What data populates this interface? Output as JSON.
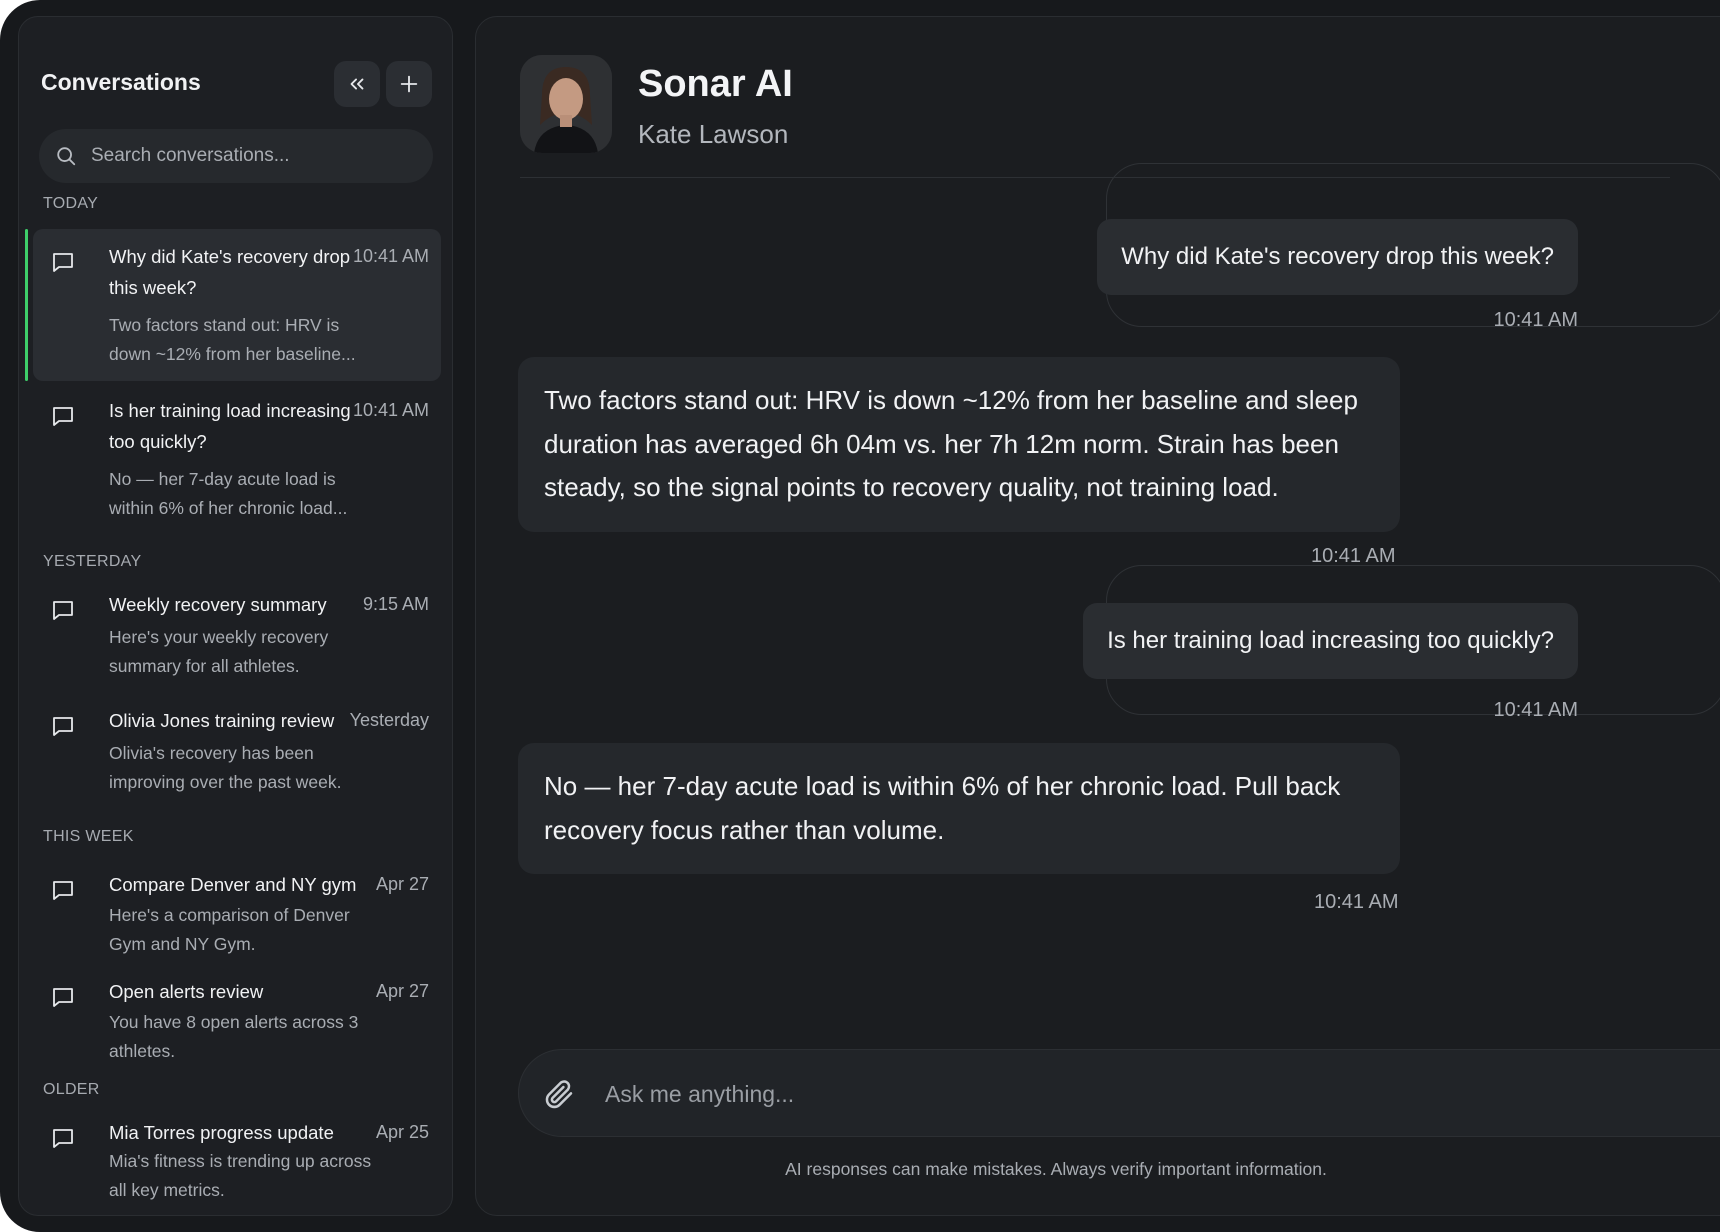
{
  "sidebar": {
    "title": "Conversations",
    "search_placeholder": "Search conversations...",
    "sections": {
      "today": "TODAY",
      "yesterday": "YESTERDAY",
      "this_week": "THIS WEEK",
      "older": "OLDER"
    },
    "conversations": [
      {
        "title": "Why did Kate's recovery drop this week?",
        "time": "10:41 AM",
        "preview": "Two factors stand out: HRV is down ~12% from her baseline...",
        "active": true
      },
      {
        "title": "Is her training load increasing too quickly?",
        "time": "10:41 AM",
        "preview": "No — her 7-day acute load is within 6% of her chronic load..."
      },
      {
        "title": "Weekly recovery summary",
        "time": "9:15 AM",
        "preview": "Here's your weekly recovery summary for all athletes."
      },
      {
        "title": "Olivia Jones training review",
        "time": "Yesterday",
        "preview": "Olivia's recovery has been improving over the past week."
      },
      {
        "title": "Compare Denver and NY gym",
        "time": "Apr 27",
        "preview": "Here's a comparison of Denver Gym and NY Gym."
      },
      {
        "title": "Open alerts review",
        "time": "Apr 27",
        "preview": "You have 8 open alerts across 3 athletes."
      },
      {
        "title": "Mia Torres progress update",
        "time": "Apr 25",
        "preview": "Mia's fitness is trending up across all key metrics."
      }
    ]
  },
  "header": {
    "agent_name": "Sonar AI",
    "athlete_name": "Kate Lawson"
  },
  "messages": [
    {
      "role": "user",
      "text": "Why did Kate's recovery drop this week?",
      "time": "10:41 AM"
    },
    {
      "role": "assistant",
      "text": "Two factors stand out: HRV is down ~12% from her baseline and sleep duration has averaged 6h 04m vs. her 7h 12m norm. Strain has been steady, so the signal points to recovery quality, not training load.",
      "time": "10:41 AM"
    },
    {
      "role": "user",
      "text": "Is her training load increasing too quickly?",
      "time": "10:41 AM"
    },
    {
      "role": "assistant",
      "text": "No — her 7-day acute load is within 6% of her chronic load. Pull back recovery focus rather than volume.",
      "time": "10:41 AM"
    }
  ],
  "composer": {
    "placeholder": "Ask me anything..."
  },
  "disclaimer": "AI responses can make mistakes. Always verify important information.",
  "colors": {
    "accent_active": "#3ecf6a",
    "background": "#17191c",
    "panel": "#1d1f23"
  },
  "icons": {
    "collapse": "chevrons-left-icon",
    "new": "plus-icon",
    "search": "search-icon",
    "conversation": "message-square-icon",
    "attach": "paperclip-icon"
  }
}
